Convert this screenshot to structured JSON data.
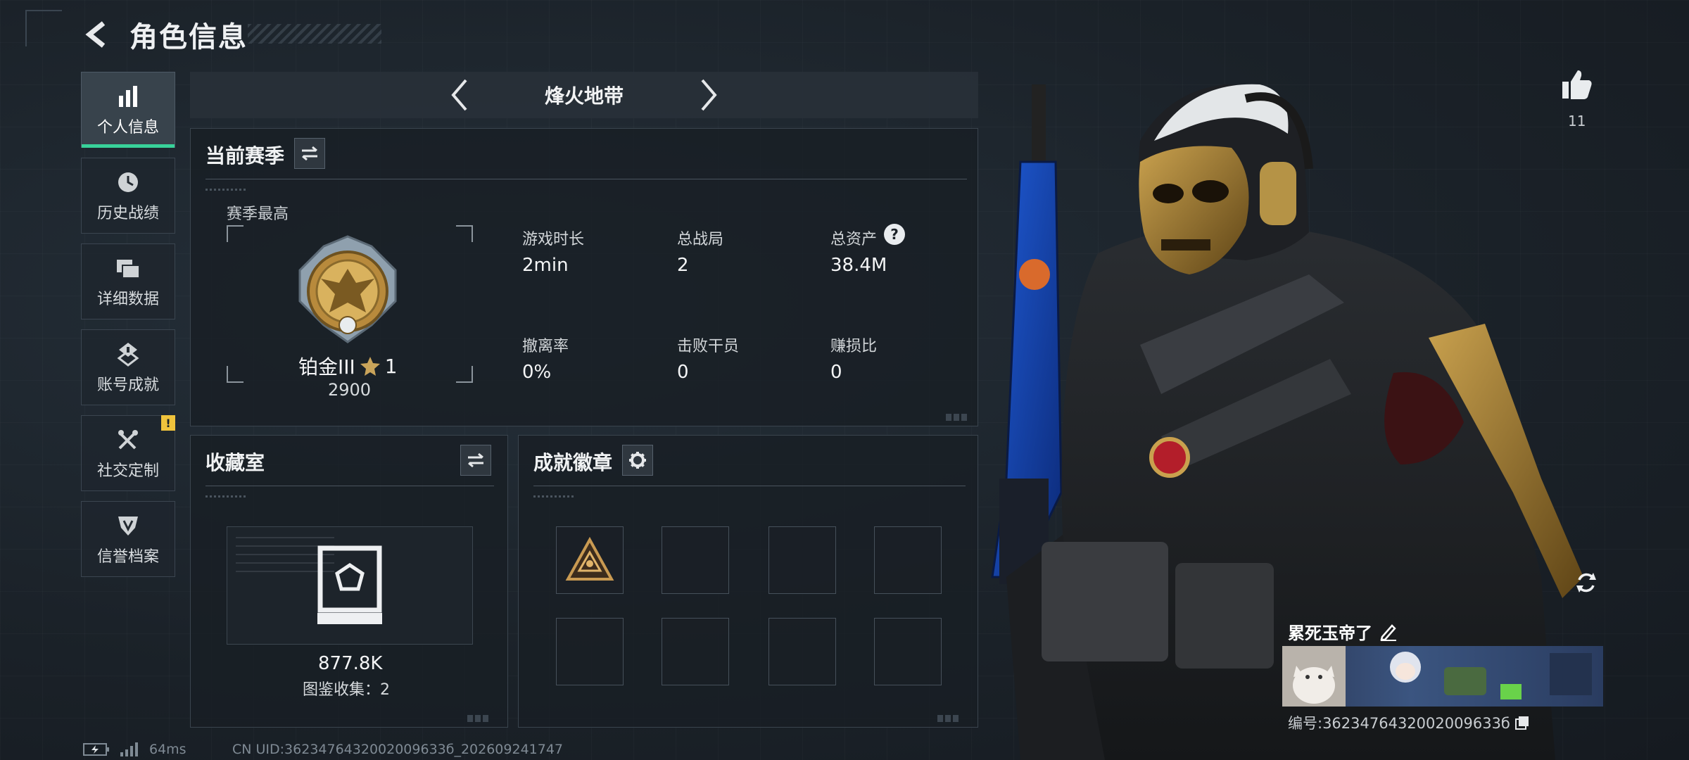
{
  "header": {
    "title": "角色信息"
  },
  "nav": {
    "items": [
      {
        "label": "个人信息",
        "icon": "bar-chart-icon",
        "active": true
      },
      {
        "label": "历史战绩",
        "icon": "clock-icon"
      },
      {
        "label": "详细数据",
        "icon": "folder-icon"
      },
      {
        "label": "账号成就",
        "icon": "medal-icon"
      },
      {
        "label": "社交定制",
        "icon": "tools-icon",
        "badge": "!"
      },
      {
        "label": "信誉档案",
        "icon": "shield-icon"
      }
    ]
  },
  "mode": {
    "title": "烽火地带"
  },
  "season": {
    "title": "当前赛季",
    "best_label": "赛季最高",
    "rank_name": "铂金III",
    "rank_stars": "1",
    "rank_score": "2900",
    "stats": [
      {
        "label": "游戏时长",
        "value": "2min"
      },
      {
        "label": "总战局",
        "value": "2"
      },
      {
        "label": "总资产",
        "value": "38.4M"
      },
      {
        "label": "撤离率",
        "value": "0%"
      },
      {
        "label": "击败干员",
        "value": "0"
      },
      {
        "label": "赚损比",
        "value": "0"
      }
    ],
    "help": "?"
  },
  "collection": {
    "title": "收藏室",
    "value": "877.8K",
    "sub": "图鉴收集：2"
  },
  "badges": {
    "title": "成就徽章"
  },
  "profile": {
    "likes": "11",
    "name": "累死玉帝了",
    "id": "编号:3623476432002009633б"
  },
  "status": {
    "ping": "64ms",
    "uid": "CN UID:3623476432002009633б_202609241747"
  },
  "colors": {
    "accent": "#38d29a",
    "badge": "#f0c33c",
    "panel": "#181e25"
  }
}
